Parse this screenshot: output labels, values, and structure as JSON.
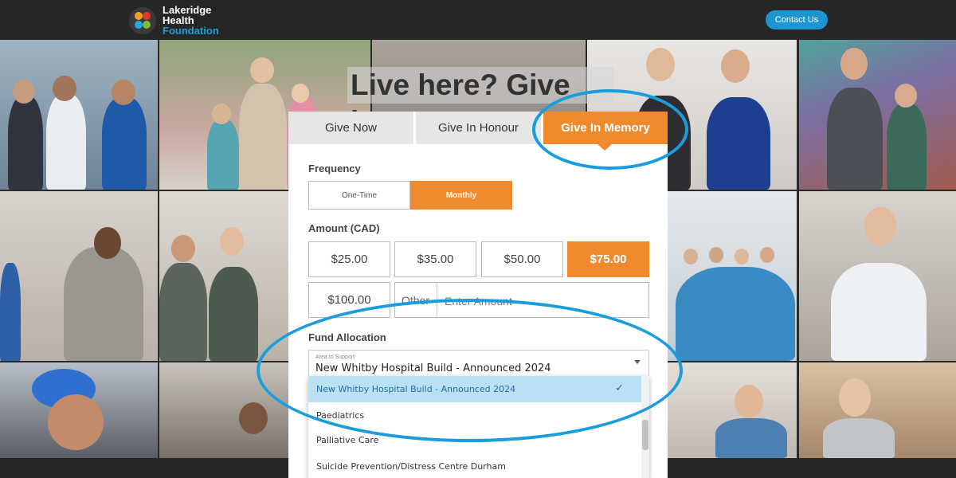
{
  "header": {
    "logo_line1": "Lakeridge",
    "logo_line2": "Health",
    "logo_line3": "Foundation",
    "contact_label": "Contact Us"
  },
  "hero": {
    "title": "Live here? Give here"
  },
  "tabs": [
    {
      "label": "Give Now",
      "active": false
    },
    {
      "label": "Give In Honour",
      "active": false
    },
    {
      "label": "Give In Memory",
      "active": true
    }
  ],
  "form": {
    "frequency_label": "Frequency",
    "frequency_options": [
      {
        "label": "One-Time",
        "selected": false
      },
      {
        "label": "Monthly",
        "selected": true
      }
    ],
    "amount_label": "Amount (CAD)",
    "amounts": [
      {
        "label": "$25.00",
        "selected": false
      },
      {
        "label": "$35.00",
        "selected": false
      },
      {
        "label": "$50.00",
        "selected": false
      },
      {
        "label": "$75.00",
        "selected": true
      },
      {
        "label": "$100.00",
        "selected": false
      }
    ],
    "other_label": "Other",
    "other_placeholder": "Enter Amount",
    "fund_label": "Fund Allocation",
    "area_small_label": "Area to Support",
    "area_value": "New Whitby Hospital Build - Announced 2024",
    "dropdown_options": [
      {
        "label": "New Whitby Hospital Build - Announced 2024",
        "selected": true
      },
      {
        "label": "Paediatrics",
        "selected": false
      },
      {
        "label": "Palliative Care",
        "selected": false
      },
      {
        "label": "Suicide Prevention/Distress Centre Durham",
        "selected": false
      }
    ]
  },
  "colors": {
    "accent_orange": "#f08a2e",
    "brand_blue": "#1e95d3",
    "annotation_blue": "#1a9ddc",
    "selected_option_bg": "#b9e0f3"
  },
  "icons": {
    "logo": "lakeridge-logo-icon",
    "select_arrow": "caret-down-icon",
    "selected_check": "check-icon"
  }
}
